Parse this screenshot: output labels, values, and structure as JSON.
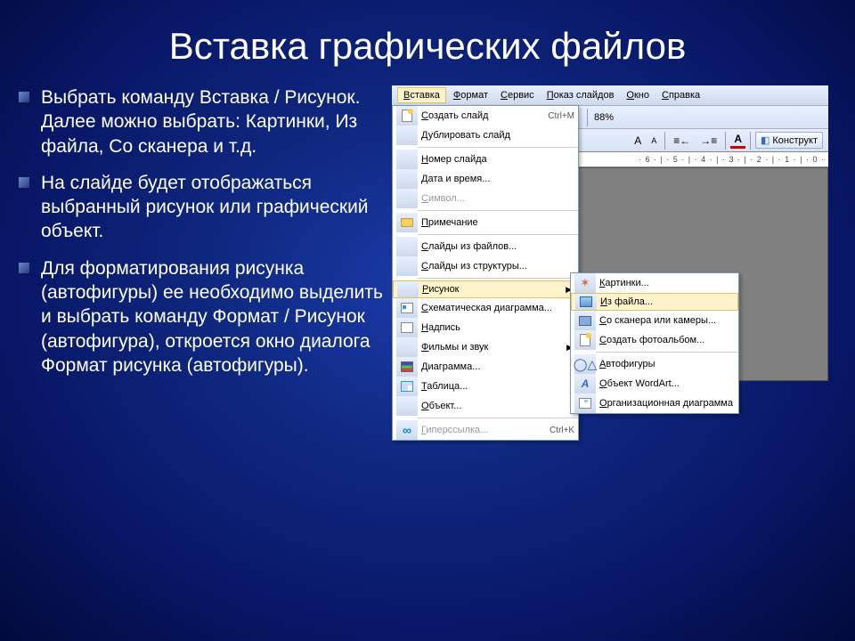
{
  "slide": {
    "title": "Вставка графических файлов",
    "bullets": [
      "Выбрать команду Вставка / Рисунок. Далее можно выбрать: Картинки, Из файла, Со сканера и т.д.",
      "На слайде будет отображаться выбранный рисунок или графический объект.",
      " Для форматирования рисунка (автофигуры) ее необходимо выделить и выбрать команду Формат / Рисунок (автофигура), откроется окно диалога Формат рисунка (автофигуры)."
    ]
  },
  "menubar": {
    "items": [
      "Вставка",
      "Формат",
      "Сервис",
      "Показ слайдов",
      "Окно",
      "Справка"
    ],
    "active_index": 0
  },
  "toolbar": {
    "zoom": "88%",
    "konstruktor": "Конструкт"
  },
  "ruler": "· 6 · | · 5 · | · 4 · | · 3 · | · 2 · | · 1 · | · 0 ·",
  "dropdown_main": [
    {
      "icon": "newslide",
      "label": "Создать слайд",
      "shortcut": "Ctrl+M",
      "enabled": true
    },
    {
      "icon": "",
      "label": "Дублировать слайд",
      "shortcut": "",
      "enabled": true
    },
    {
      "sep": true
    },
    {
      "icon": "",
      "label": "Номер слайда",
      "enabled": true
    },
    {
      "icon": "",
      "label": "Дата и время...",
      "enabled": true
    },
    {
      "icon": "",
      "label": "Символ...",
      "enabled": false
    },
    {
      "sep": true
    },
    {
      "icon": "folder",
      "label": "Примечание",
      "enabled": true
    },
    {
      "sep": true
    },
    {
      "icon": "",
      "label": "Слайды из файлов...",
      "enabled": true
    },
    {
      "icon": "",
      "label": "Слайды из структуры...",
      "enabled": true
    },
    {
      "sep": true
    },
    {
      "icon": "",
      "label": "Рисунок",
      "enabled": true,
      "submenu": true,
      "highlight": true
    },
    {
      "icon": "diag",
      "label": "Схематическая диаграмма...",
      "enabled": true
    },
    {
      "icon": "text",
      "label": "Надпись",
      "enabled": true
    },
    {
      "icon": "",
      "label": "Фильмы и звук",
      "enabled": true,
      "submenu": true
    },
    {
      "icon": "chart",
      "label": "Диаграмма...",
      "enabled": true
    },
    {
      "icon": "table",
      "label": "Таблица...",
      "enabled": true
    },
    {
      "icon": "",
      "label": "Объект...",
      "enabled": true
    },
    {
      "sep": true
    },
    {
      "icon": "link",
      "label": "Гиперссылка...",
      "shortcut": "Ctrl+K",
      "enabled": false
    }
  ],
  "dropdown_sub": [
    {
      "icon": "clip",
      "label": "Картинки...",
      "enabled": true
    },
    {
      "icon": "pic",
      "label": "Из файла...",
      "enabled": true,
      "highlight": true
    },
    {
      "icon": "scan",
      "label": "Со сканера или камеры...",
      "enabled": true
    },
    {
      "icon": "newslide",
      "label": "Создать фотоальбом...",
      "enabled": true
    },
    {
      "sep": true
    },
    {
      "icon": "shapes",
      "label": "Автофигуры",
      "enabled": true
    },
    {
      "icon": "wordart",
      "label": "Объект WordArt...",
      "enabled": true
    },
    {
      "icon": "org",
      "label": "Организационная диаграмма",
      "enabled": true
    }
  ]
}
